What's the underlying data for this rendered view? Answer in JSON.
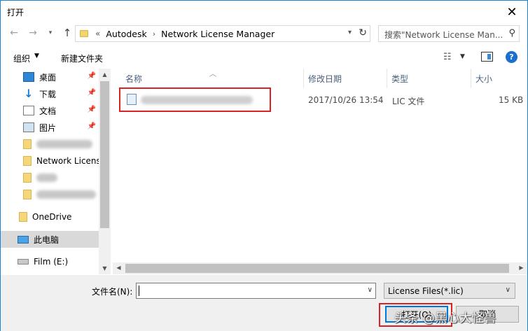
{
  "window": {
    "title": "打开",
    "close_glyph": "✕"
  },
  "nav": {
    "back_glyph": "←",
    "forward_glyph": "→",
    "up_glyph": "↑",
    "address": {
      "overflow": "«",
      "segments": [
        "Autodesk",
        "Network License Manager"
      ],
      "separator": "›"
    },
    "search_placeholder": "搜索\"Network License Man...\""
  },
  "toolbar": {
    "organize_label": "组织",
    "new_folder_label": "新建文件夹",
    "help_label": "?"
  },
  "sidebar": {
    "items": [
      {
        "label": "桌面",
        "icon": "desktop-icon",
        "pinned": true
      },
      {
        "label": "下载",
        "icon": "download-icon",
        "pinned": true
      },
      {
        "label": "文档",
        "icon": "document-icon",
        "pinned": true
      },
      {
        "label": "图片",
        "icon": "pictures-icon",
        "pinned": true
      },
      {
        "label": "",
        "icon": "folder-icon",
        "redacted": true
      },
      {
        "label": "Network Licens",
        "icon": "folder-icon"
      },
      {
        "label": "",
        "icon": "folder-icon",
        "redacted": true
      },
      {
        "label": "",
        "icon": "folder-icon",
        "redacted": true
      },
      {
        "label": "OneDrive",
        "icon": "folder-icon"
      },
      {
        "label": "此电脑",
        "icon": "pc-icon",
        "selected": true
      },
      {
        "label": "Film (E:)",
        "icon": "drive-icon"
      }
    ],
    "pin_glyph": "📌"
  },
  "file_list": {
    "columns": [
      "名称",
      "修改日期",
      "类型",
      "大小"
    ],
    "rows": [
      {
        "name": "",
        "redacted": true,
        "modified": "2017/10/26 13:54",
        "type": "LIC 文件",
        "size": "15 KB"
      }
    ]
  },
  "bottom": {
    "filename_label": "文件名(N):",
    "filename_value": "",
    "filter_value": "License Files(*.lic)",
    "open_label": "打开(O)",
    "cancel_label": "取消",
    "watermark": "头条 @黑心大怪兽"
  },
  "colors": {
    "highlight_red": "#d92323",
    "accent_blue": "#0078d7"
  }
}
